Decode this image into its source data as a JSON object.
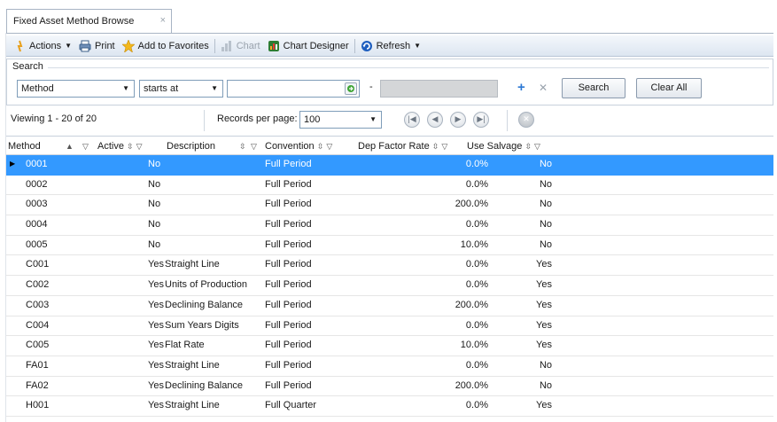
{
  "tab": {
    "title": "Fixed Asset Method Browse",
    "close": "×"
  },
  "toolbar": {
    "actions": "Actions",
    "print": "Print",
    "favorites": "Add to Favorites",
    "chart": "Chart",
    "chart_designer": "Chart Designer",
    "refresh": "Refresh"
  },
  "search": {
    "label": "Search",
    "field": "Method",
    "operator": "starts at",
    "value": "",
    "dash": "-",
    "search_button": "Search",
    "clear_button": "Clear All"
  },
  "pager": {
    "viewing": "Viewing  1 - 20  of  20",
    "records_label": "Records per page:",
    "records_value": "100"
  },
  "columns": {
    "method": "Method",
    "active": "Active",
    "description": "Description",
    "convention": "Convention",
    "dep_factor_rate": "Dep Factor Rate",
    "use_salvage": "Use Salvage"
  },
  "rows": [
    {
      "method": "0001",
      "active": "No",
      "description": "",
      "convention": "Full Period",
      "rate": "0.0%",
      "salvage": "No"
    },
    {
      "method": "0002",
      "active": "No",
      "description": "",
      "convention": "Full Period",
      "rate": "0.0%",
      "salvage": "No"
    },
    {
      "method": "0003",
      "active": "No",
      "description": "",
      "convention": "Full Period",
      "rate": "200.0%",
      "salvage": "No"
    },
    {
      "method": "0004",
      "active": "No",
      "description": "",
      "convention": "Full Period",
      "rate": "0.0%",
      "salvage": "No"
    },
    {
      "method": "0005",
      "active": "No",
      "description": "",
      "convention": "Full Period",
      "rate": "10.0%",
      "salvage": "No"
    },
    {
      "method": "C001",
      "active": "Yes",
      "description": "Straight Line",
      "convention": "Full Period",
      "rate": "0.0%",
      "salvage": "Yes"
    },
    {
      "method": "C002",
      "active": "Yes",
      "description": "Units of Production",
      "convention": "Full Period",
      "rate": "0.0%",
      "salvage": "Yes"
    },
    {
      "method": "C003",
      "active": "Yes",
      "description": "Declining Balance",
      "convention": "Full Period",
      "rate": "200.0%",
      "salvage": "Yes"
    },
    {
      "method": "C004",
      "active": "Yes",
      "description": "Sum Years Digits",
      "convention": "Full Period",
      "rate": "0.0%",
      "salvage": "Yes"
    },
    {
      "method": "C005",
      "active": "Yes",
      "description": "Flat Rate",
      "convention": "Full Period",
      "rate": "10.0%",
      "salvage": "Yes"
    },
    {
      "method": "FA01",
      "active": "Yes",
      "description": "Straight Line",
      "convention": "Full Period",
      "rate": "0.0%",
      "salvage": "No"
    },
    {
      "method": "FA02",
      "active": "Yes",
      "description": "Declining Balance",
      "convention": "Full Period",
      "rate": "200.0%",
      "salvage": "No"
    },
    {
      "method": "H001",
      "active": "Yes",
      "description": "Straight Line",
      "convention": "Full Quarter",
      "rate": "0.0%",
      "salvage": "Yes"
    }
  ],
  "colors": {
    "selected_row": "#3399ff",
    "refresh_icon": "#1f5fbf",
    "favorites_icon": "#f3b81d"
  }
}
